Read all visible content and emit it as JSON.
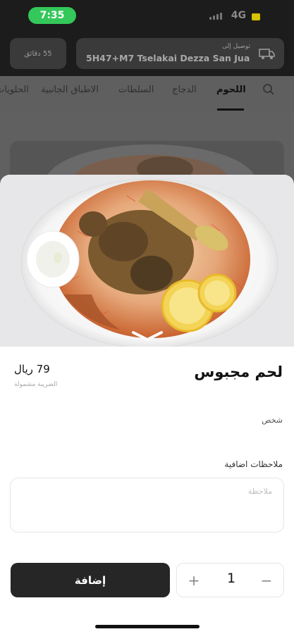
{
  "status": {
    "time": "7:35",
    "network": "4G"
  },
  "header": {
    "delivery_time": "55 دقائق",
    "deliver_label": "توصيل إلى",
    "address": "5H47+M7 Tselakai Dezza San Juan..."
  },
  "tabs": [
    "اللحوم",
    "الدجاج",
    "السلطات",
    "الاطباق الجانبية",
    "الحلويات"
  ],
  "active_tab": 0,
  "product": {
    "title": "لحم مجبوس",
    "price": "79 ريال",
    "tax_note": "الضريبة مشمولة",
    "person_label": "شخص",
    "notes_label": "ملاحظات اضافية",
    "notes_placeholder": "ملاحظة",
    "quantity": "1",
    "add_label": "إضافة"
  },
  "icons": [
    "search-icon",
    "truck-icon",
    "chevron-down-icon",
    "plus-icon",
    "minus-icon"
  ],
  "colors": {
    "status_pill": "#34c759",
    "button": "#262626"
  }
}
